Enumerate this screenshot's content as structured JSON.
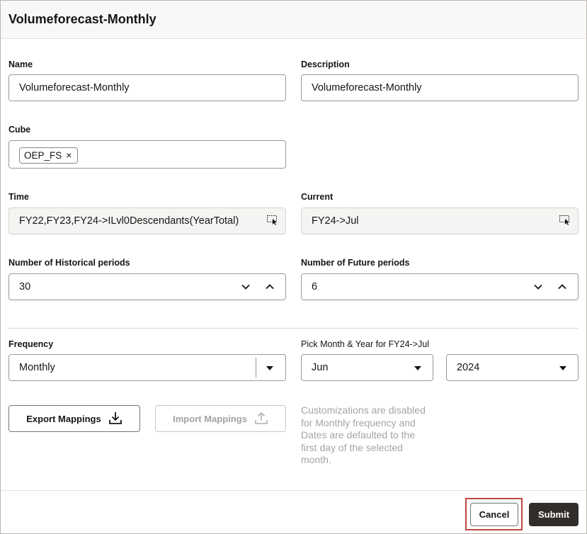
{
  "dialog": {
    "title": "Volumeforecast-Monthly"
  },
  "form": {
    "name": {
      "label": "Name",
      "value": "Volumeforecast-Monthly"
    },
    "description": {
      "label": "Description",
      "value": "Volumeforecast-Monthly"
    },
    "cube": {
      "label": "Cube",
      "chip": "OEP_FS",
      "chip_remove": "×"
    },
    "time": {
      "label": "Time",
      "value": "FY22,FY23,FY24->ILvl0Descendants(YearTotal)"
    },
    "current": {
      "label": "Current",
      "value": "FY24->Jul"
    },
    "historical_periods": {
      "label": "Number of Historical periods",
      "value": "30"
    },
    "future_periods": {
      "label": "Number of Future periods",
      "value": "6"
    },
    "frequency": {
      "label": "Frequency",
      "value": "Monthly"
    },
    "pick_month_year": {
      "label": "Pick Month & Year for FY24->Jul",
      "month": "Jun",
      "year": "2024"
    }
  },
  "actions": {
    "export_label": "Export Mappings",
    "import_label": "Import Mappings",
    "note": "Customizations are disabled for Monthly frequency and Dates are defaulted to the first day of the selected month."
  },
  "footer": {
    "cancel_label": "Cancel",
    "submit_label": "Submit"
  },
  "colors": {
    "accent": "#312d2a",
    "highlight": "#c0483e",
    "disabled": "#a7a4a0"
  }
}
